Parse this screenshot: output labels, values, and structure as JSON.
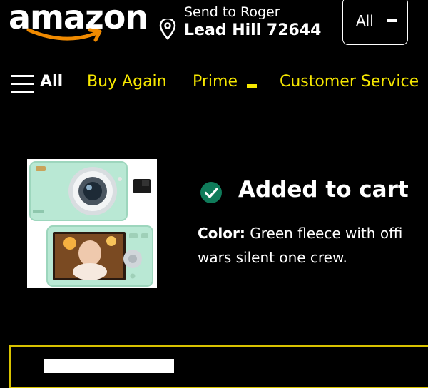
{
  "header": {
    "logo_text": "amazon",
    "deliver_line1": "Send to Roger",
    "deliver_line2": "Lead Hill 72644",
    "search_category": "All"
  },
  "nav": {
    "all_label": "All",
    "items": [
      "Buy Again",
      "Prime",
      "Customer Service"
    ]
  },
  "cart": {
    "title": "Added to cart",
    "color_label": "Color:",
    "color_value": "Green fleece with offi",
    "color_value_line2": "wars silent one crew."
  },
  "colors": {
    "background": "#000000",
    "nav_text": "#f7e800",
    "smile": "#f08a00",
    "check": "#0f7b5a",
    "panel_border": "#d8c200"
  },
  "icons": {
    "logo_smile": "amazon-smile-arrow",
    "location": "map-pin-icon",
    "menu": "hamburger-icon",
    "check": "check-circle-icon",
    "dropdown": "dash-icon"
  }
}
